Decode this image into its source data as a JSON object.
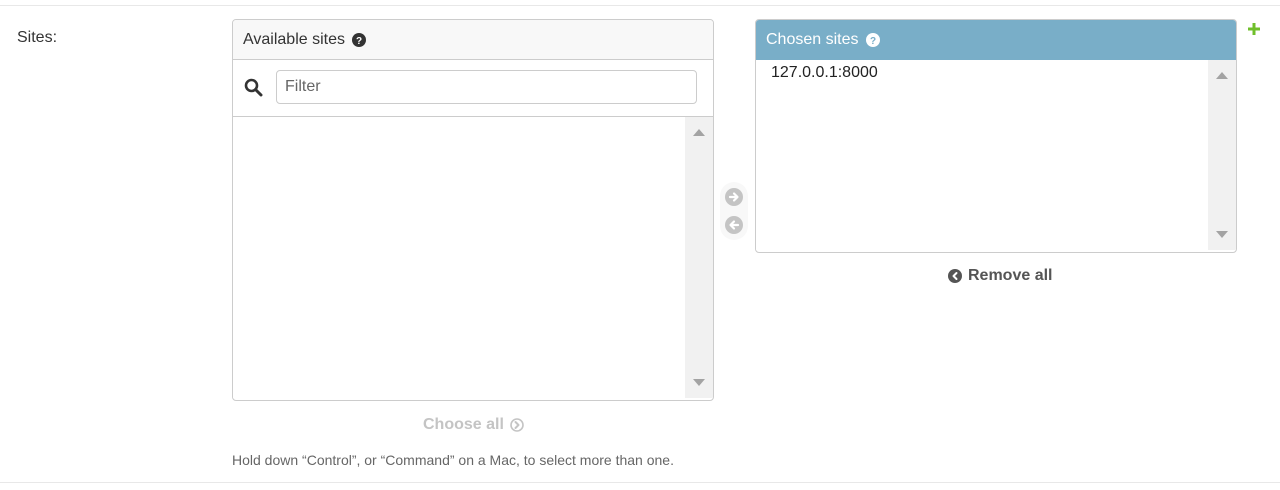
{
  "field": {
    "label": "Sites:"
  },
  "available": {
    "title": "Available sites",
    "help_icon": "question-circle-icon",
    "filter_placeholder": "Filter",
    "filter_value": "",
    "search_icon": "search-icon",
    "options": []
  },
  "chosen": {
    "title": "Chosen sites",
    "help_icon": "question-circle-icon",
    "options": [
      "127.0.0.1:8000"
    ]
  },
  "actions": {
    "choose_all": "Choose all",
    "remove_all": "Remove all",
    "choose_icon": "arrow-right-circle-icon",
    "remove_icon": "arrow-left-circle-icon",
    "add_icon": "plus-icon"
  },
  "help_text": "Hold down “Control”, or “Command” on a Mac, to select more than one.",
  "colors": {
    "chosen_header": "#79aec8",
    "add_green": "#70bf2b",
    "disabled": "#c4c4c4"
  }
}
